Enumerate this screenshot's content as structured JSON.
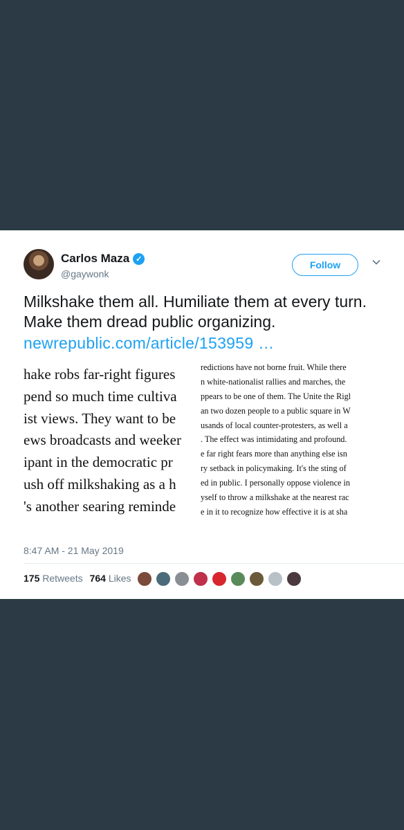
{
  "tweet": {
    "author_name": "Carlos Maza",
    "handle": "@gaywonk",
    "follow_label": "Follow",
    "text": "Milkshake them all. Humiliate them at every turn. Make them dread public organizing.",
    "link_text": "newrepublic.com/article/153959 …",
    "timestamp": "8:47 AM - 21 May 2019",
    "retweets_count": "175",
    "retweets_label": "Retweets",
    "likes_count": "764",
    "likes_label": "Likes"
  },
  "article": {
    "left_lines": [
      "hake robs far-right figures",
      "pend so much time cultiva",
      "ist views. They want to be",
      "ews broadcasts and weeker",
      "ipant in the democratic pr",
      "ush off milkshaking as a h",
      "'s another searing reminde"
    ],
    "right_lines": [
      "redictions have not borne fruit. While there",
      "n white-nationalist rallies and marches, the",
      "ppears to be one of them. The Unite the Rigl",
      "an two dozen people to a public square in W",
      "usands of local counter-protesters, as well a",
      ". The effect was intimidating and profound.",
      "e far right fears more than anything else isn",
      "ry setback in policymaking. It's the sting of",
      "ed in public. I personally oppose violence in",
      "yself to throw a milkshake at the nearest rac",
      "e in it to recognize how effective it is at sha"
    ]
  },
  "colors": {
    "background": "#2b3a44",
    "accent": "#1da1f2",
    "text_primary": "#14171a",
    "text_secondary": "#657786"
  },
  "liker_avatars": [
    "#7a4b3a",
    "#4b6b7a",
    "#8a8f95",
    "#c0304a",
    "#d8262f",
    "#5a8a5a",
    "#6b5a3a",
    "#b8c0c8",
    "#4a3a40"
  ]
}
